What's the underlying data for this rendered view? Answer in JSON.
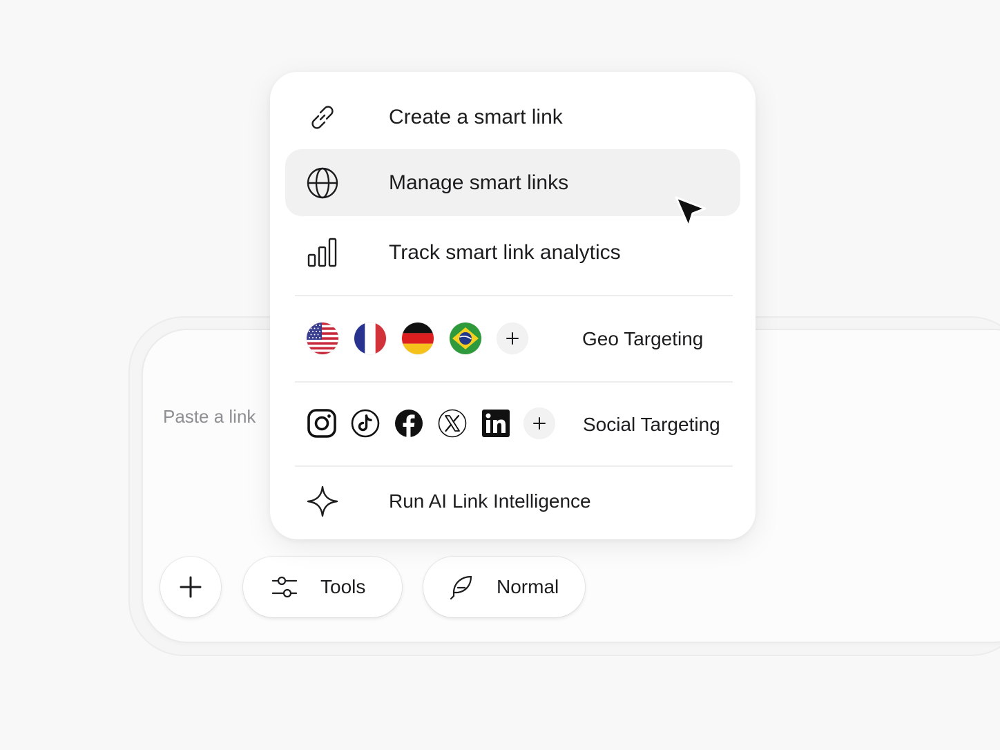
{
  "composer": {
    "placeholder": "Paste a link",
    "tools_label": "Tools",
    "mode_label": "Normal"
  },
  "menu": {
    "items": [
      {
        "label": "Create a smart link",
        "icon": "link-icon"
      },
      {
        "label": "Manage smart links",
        "icon": "globe-icon",
        "highlighted": true
      },
      {
        "label": "Track smart link analytics",
        "icon": "bar-chart-icon"
      }
    ],
    "geo": {
      "label": "Geo Targeting",
      "flags": [
        "us-flag-icon",
        "france-flag-icon",
        "germany-flag-icon",
        "brazil-flag-icon"
      ]
    },
    "social": {
      "label": "Social Targeting",
      "icons": [
        "instagram-icon",
        "tiktok-icon",
        "facebook-icon",
        "x-icon",
        "linkedin-icon"
      ]
    },
    "ai": {
      "label": "Run AI Link Intelligence",
      "icon": "sparkle-icon"
    }
  },
  "colors": {
    "hover_bg": "#f1f1f1",
    "text": "#1d1d1f",
    "placeholder": "#8e8e93"
  }
}
